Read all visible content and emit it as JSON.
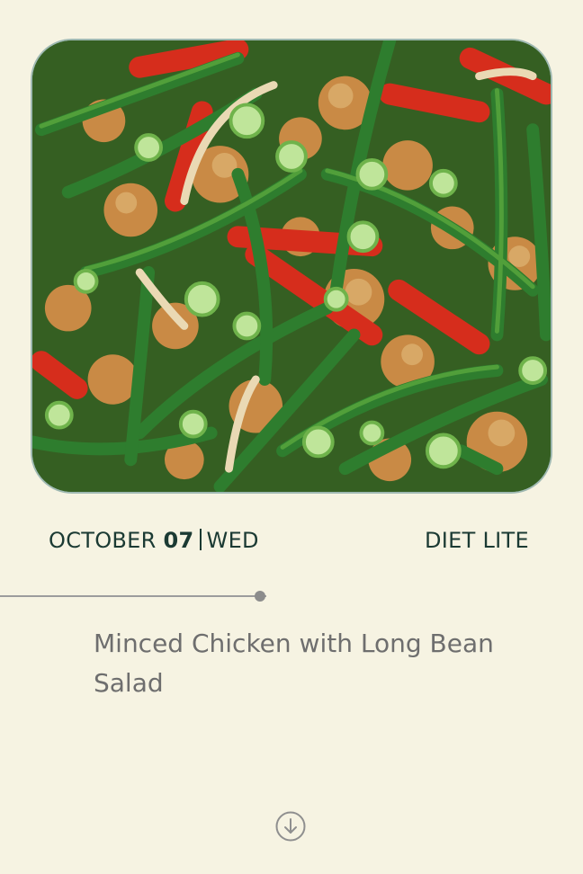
{
  "meal": {
    "month": "OCTOBER",
    "day": "07",
    "weekday": "WED",
    "diet_plan": "DIET LITE",
    "title": "Minced Chicken with Long Bean Salad"
  },
  "icons": {
    "scroll": "arrow-down-circle-icon"
  },
  "colors": {
    "background": "#f6f3e2",
    "text_dark": "#1b3a33",
    "title_gray": "#6e6e6e",
    "image_border": "#9fb9b2"
  }
}
